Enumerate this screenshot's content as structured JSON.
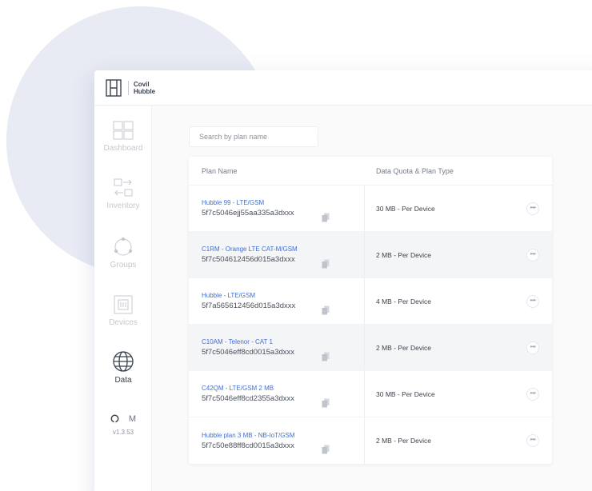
{
  "brand": {
    "line1": "Covil",
    "line2": "Hubble"
  },
  "sidebar": {
    "items": [
      {
        "label": "Dashboard",
        "icon": "dashboard-grid-icon"
      },
      {
        "label": "Inventory",
        "icon": "inventory-arrows-icon"
      },
      {
        "label": "Groups",
        "icon": "groups-circle-icon"
      },
      {
        "label": "Devices",
        "icon": "devices-chip-icon"
      },
      {
        "label": "Data",
        "icon": "globe-icon",
        "active": true
      }
    ],
    "footer": {
      "github_icon": "github-icon",
      "mail_icon": "mail-icon",
      "mail_glyph": "M",
      "version": "v1.3.53"
    }
  },
  "search": {
    "placeholder": "Search by plan name",
    "value": ""
  },
  "table": {
    "columns": [
      "Plan Name",
      "Data Quota & Plan Type"
    ],
    "rows": [
      {
        "name": "Hubble 99 - LTE/GSM",
        "id": "5f7c5046ejj55aa335a3dxxx",
        "quota": "30 MB - Per Device"
      },
      {
        "name": "C1RM - Orange LTE CAT-M/GSM",
        "id": "5f7c504612456d015a3dxxx",
        "quota": "2 MB - Per Device"
      },
      {
        "name": "Hubble - LTE/GSM",
        "id": "5f7a565612456d015a3dxxx",
        "quota": "4 MB - Per Device"
      },
      {
        "name": "C10AM - Telenor - CAT 1",
        "id": "5f7c5046eff8cd0015a3dxxx",
        "quota": "2 MB - Per Device"
      },
      {
        "name": "C42QM - LTE/GSM 2 MB",
        "id": "5f7c5046eff8cd2355a3dxxx",
        "quota": "30 MB - Per Device"
      },
      {
        "name": "Hubble plan 3 MB - NB-IoT/GSM",
        "id": "5f7c50e88ff8cd0015a3dxxx",
        "quota": "2 MB - Per Device"
      }
    ],
    "more_label": "•••"
  },
  "colors": {
    "accent": "#3f6fd6",
    "sidebar_active": "#2e3648",
    "background_blob": "#e8eaf4"
  }
}
